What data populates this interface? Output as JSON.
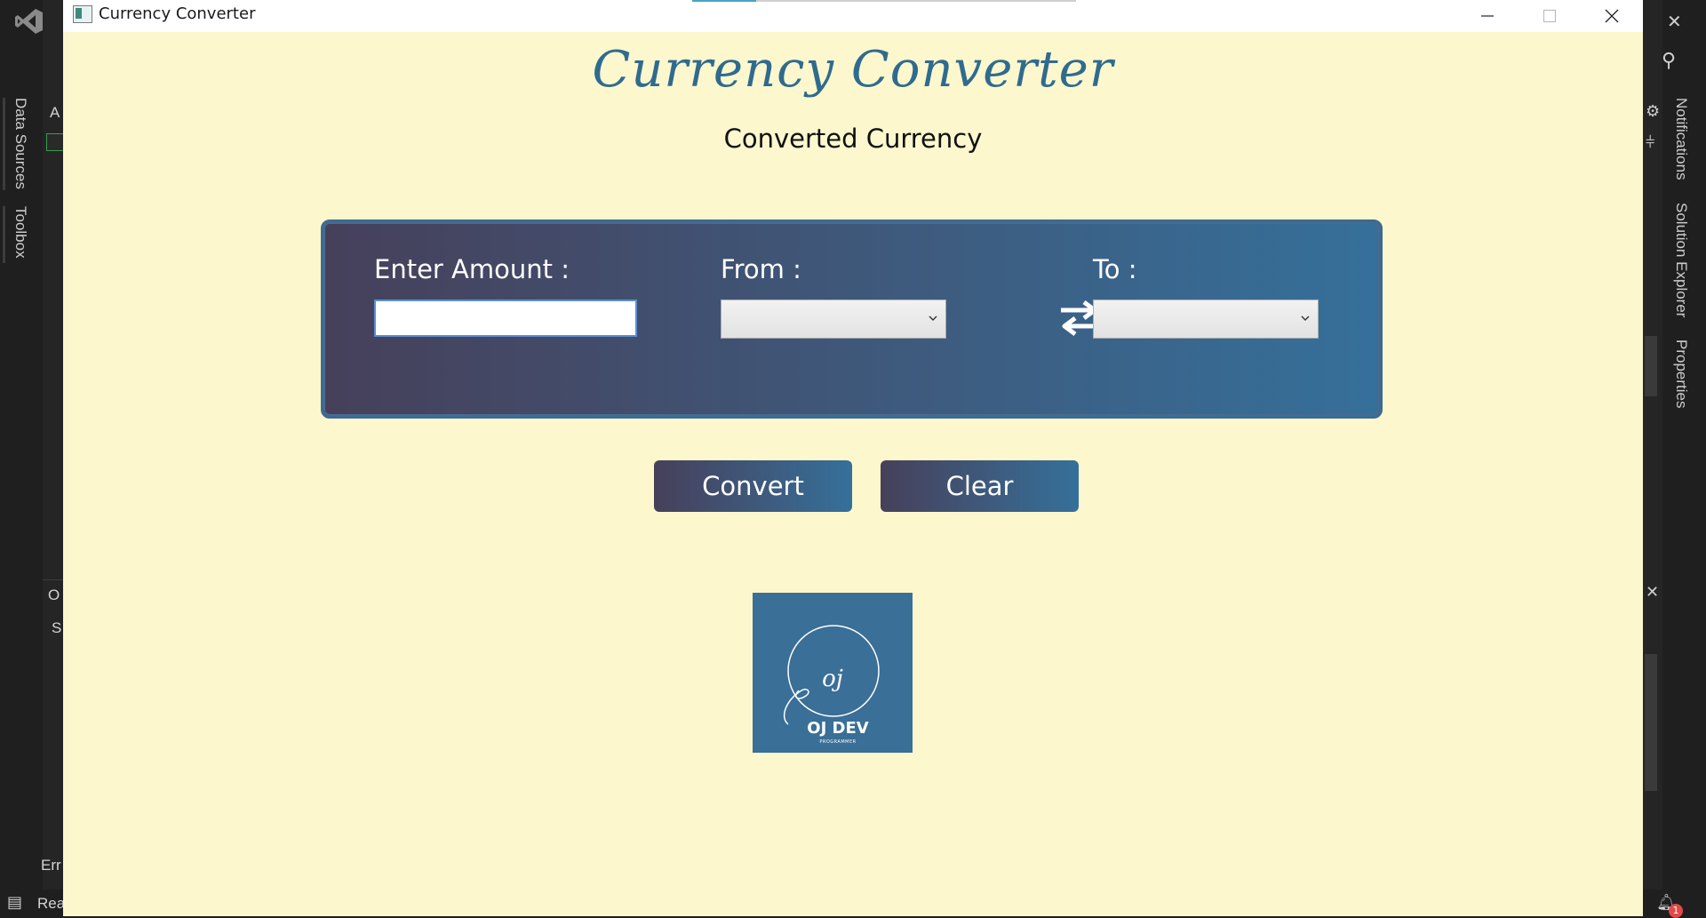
{
  "window": {
    "title": "Currency Converter",
    "controls": [
      "minimize",
      "maximize",
      "close"
    ]
  },
  "app": {
    "heading": "Currency Converter",
    "subheading": "Converted Currency",
    "amount_label": "Enter Amount :",
    "amount_value": "",
    "from_label": "From :",
    "from_selected": "",
    "to_label": "To :",
    "to_selected": "",
    "convert_label": "Convert",
    "clear_label": "Clear",
    "logo": {
      "monogram": "oj",
      "name": "OJ DEV",
      "tagline": "PROGRAMMER"
    }
  },
  "ide": {
    "left_tabs": [
      "Data Sources",
      "Toolbox"
    ],
    "right_tabs": [
      "Notifications",
      "Solution Explorer",
      "Properties"
    ],
    "fragments": {
      "a": "A",
      "o": "O",
      "s": "S",
      "err": "Err",
      "status": "Rea",
      "notification_count": "1"
    }
  },
  "colors": {
    "app_background": "#fcf7cd",
    "accent": "#2f6b8e",
    "gradient_start": "#46405a",
    "gradient_end": "#35709a",
    "ide_background": "#1f1f1f"
  },
  "icons": [
    "visual-studio-logo-icon",
    "app-icon",
    "minimize-icon",
    "maximize-icon",
    "close-icon",
    "swap-arrows-icon",
    "chevron-down-icon",
    "feedback-icon",
    "notifications-bell-icon",
    "settings-gear-icon"
  ]
}
